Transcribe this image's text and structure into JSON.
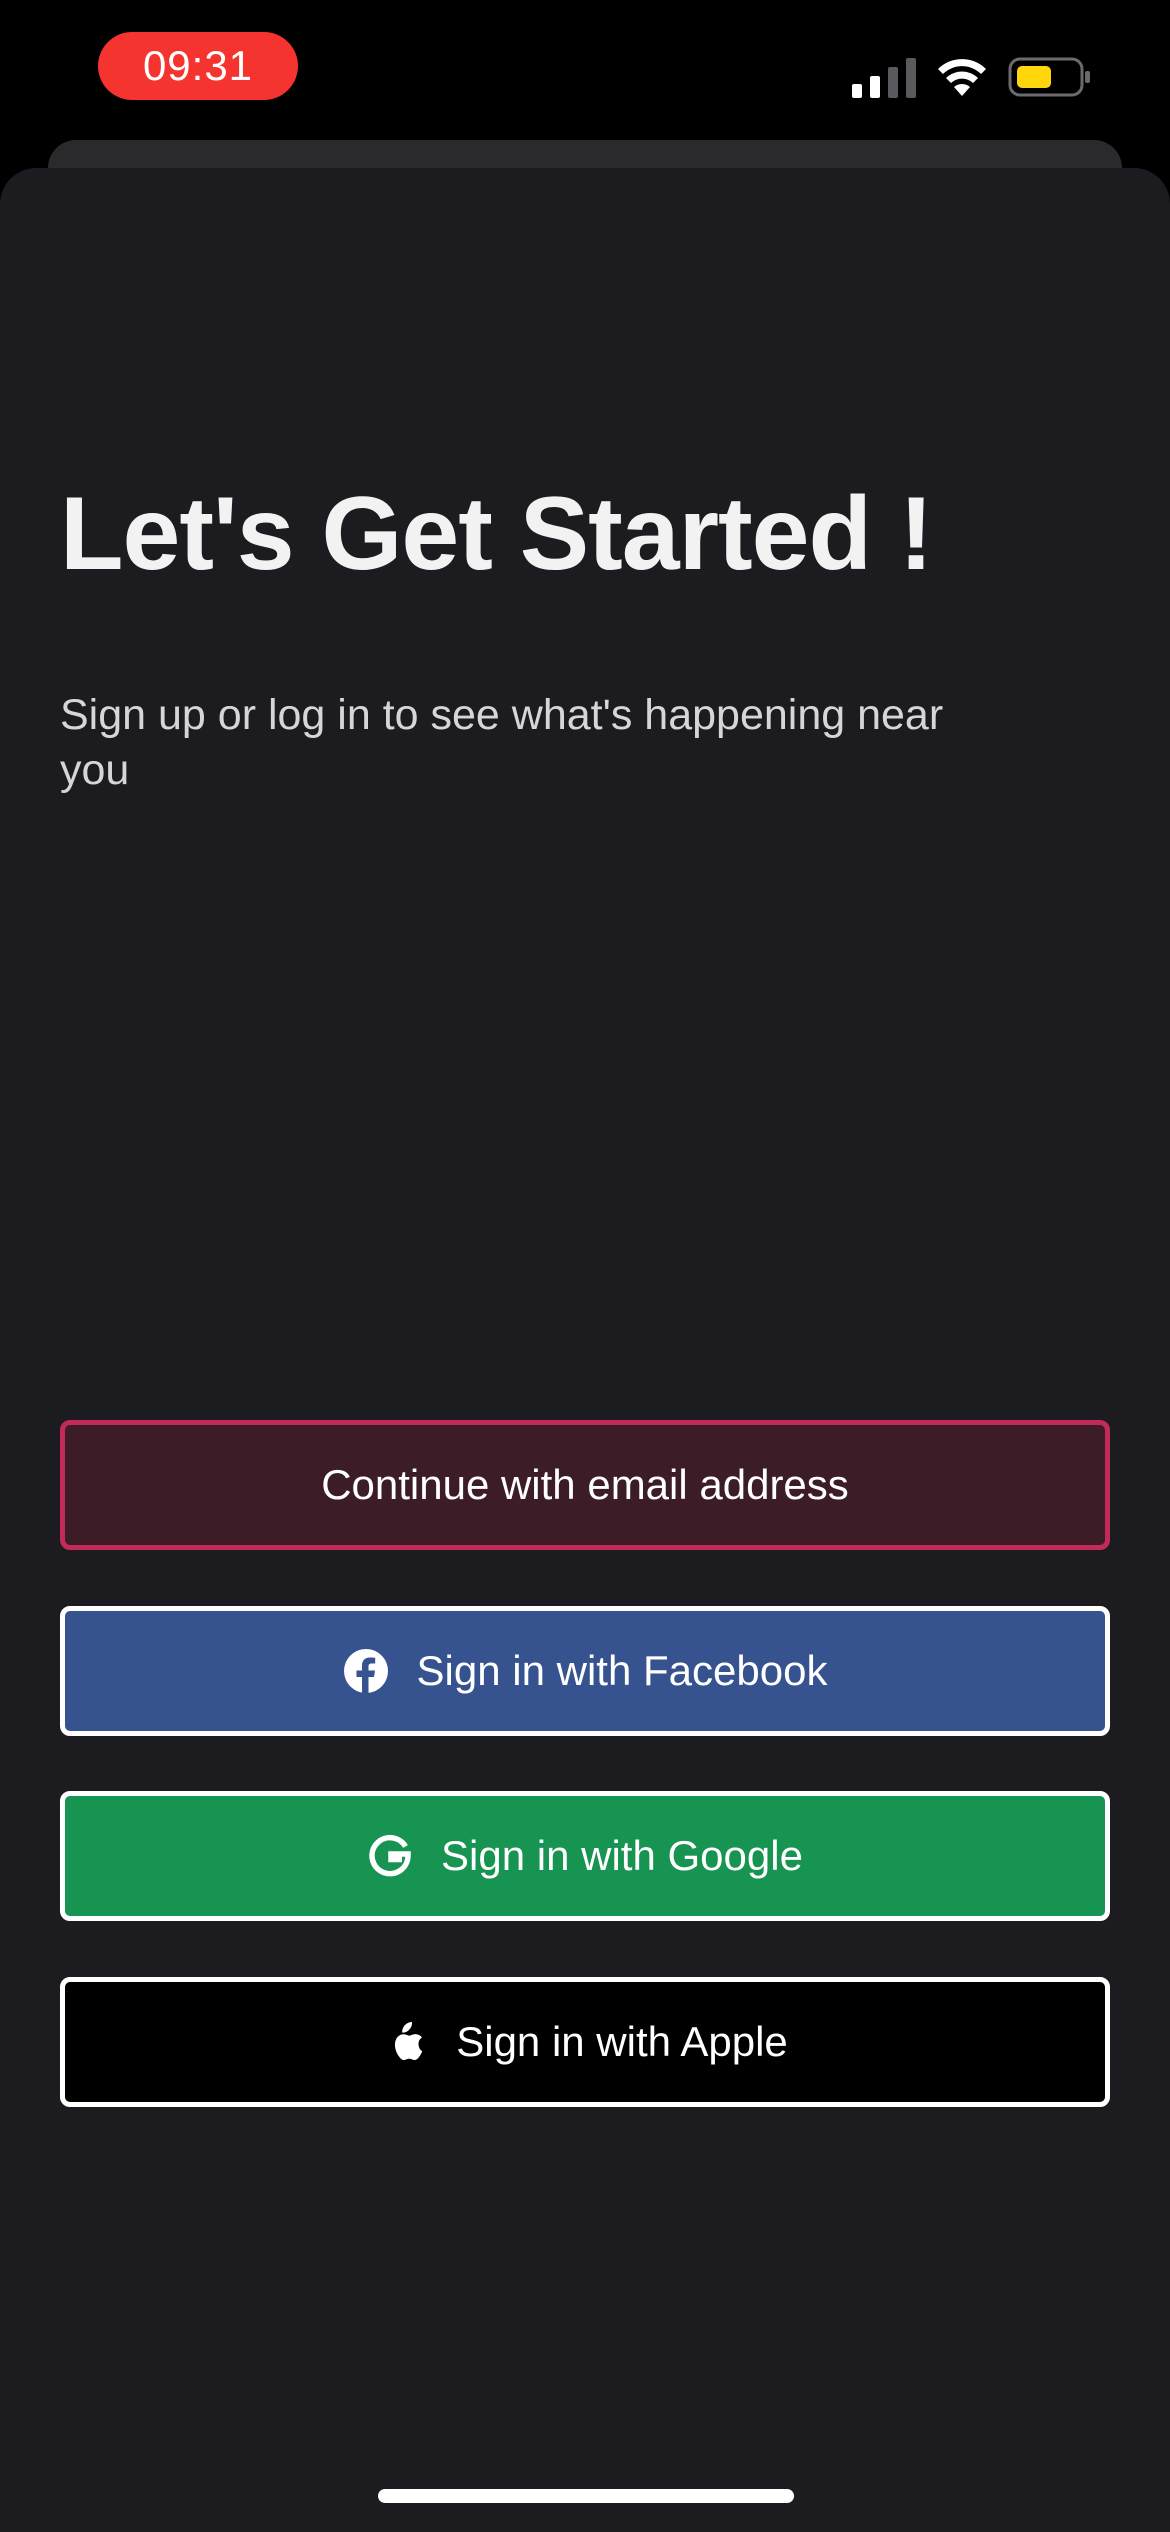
{
  "status_bar": {
    "time": "09:31",
    "time_pill_color": "#f5342f",
    "icons": [
      "signal-icon",
      "wifi-icon",
      "battery-icon"
    ],
    "battery_color": "#ffd60a"
  },
  "header": {
    "title": "Let's Get Started !",
    "subtitle": "Sign up or log in to see what's happening near you"
  },
  "buttons": {
    "email": {
      "label": "Continue with email address",
      "color": "#3c1d27",
      "border": "#c42a57"
    },
    "facebook": {
      "label": "Sign in with Facebook",
      "icon": "facebook-icon",
      "color": "#37538f"
    },
    "google": {
      "label": "Sign in with Google",
      "icon": "google-icon",
      "color": "#179451"
    },
    "apple": {
      "label": "Sign in with Apple",
      "icon": "apple-icon",
      "color": "#000000"
    }
  },
  "colors": {
    "background": "#1c1b1f",
    "text": "#f2f2f2"
  }
}
